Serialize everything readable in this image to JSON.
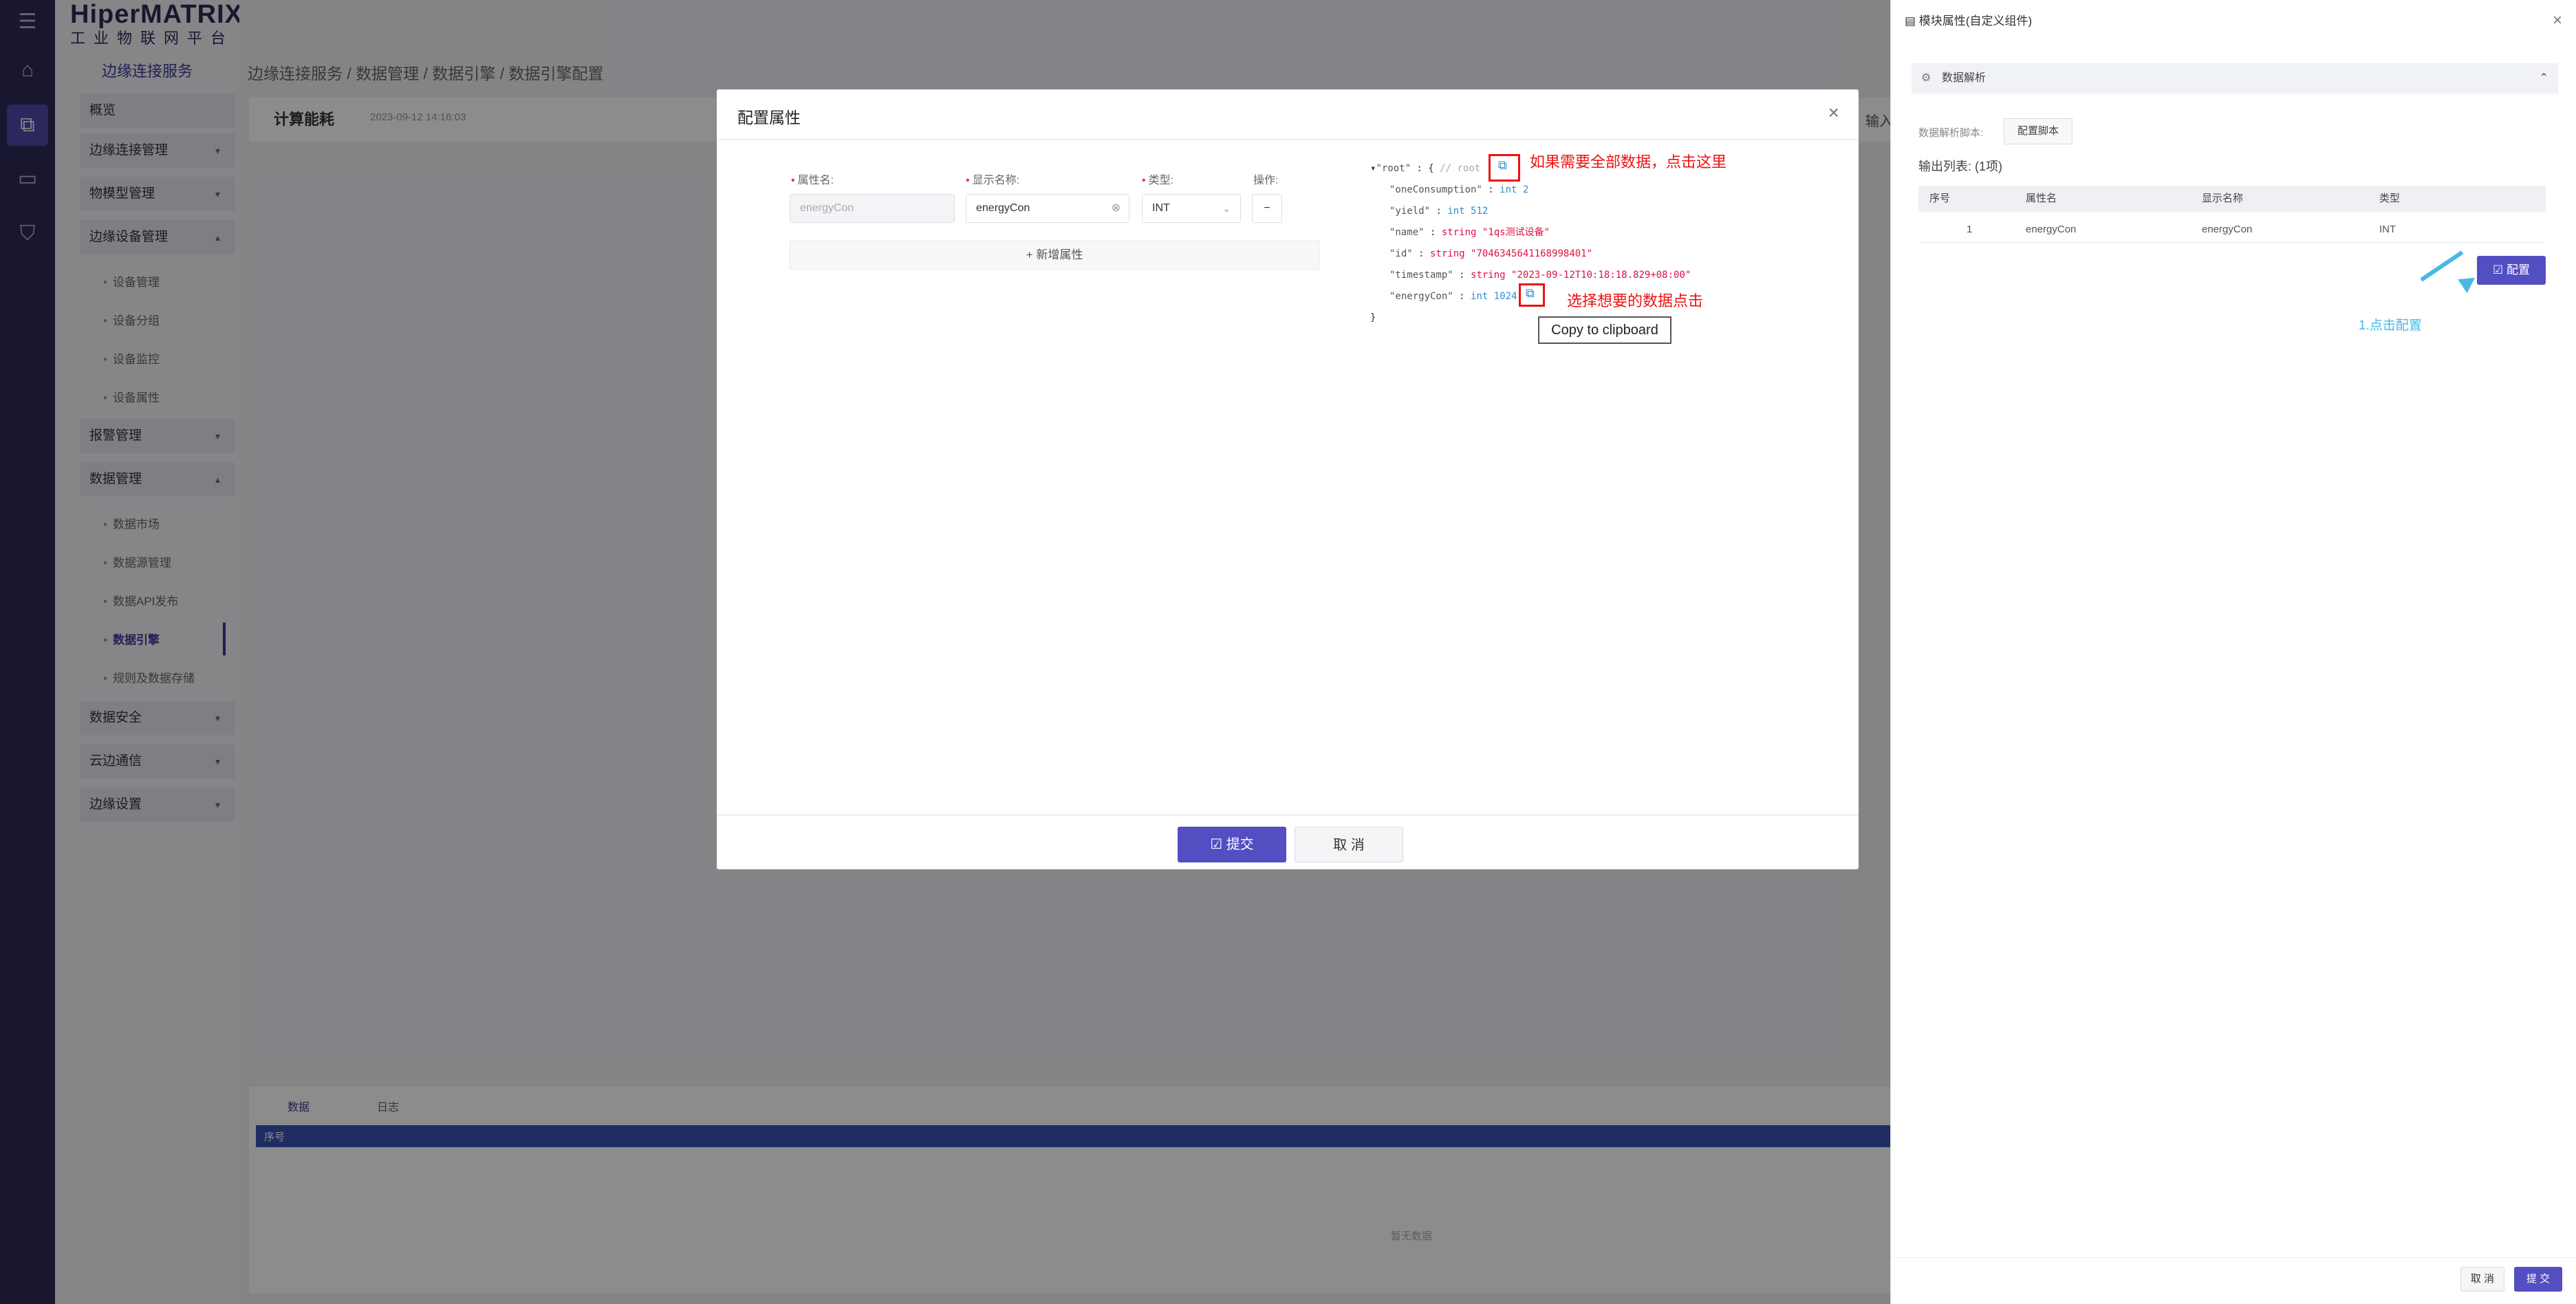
{
  "app": {
    "logo_brand": "HiperMATRIX",
    "logo_sub": "工业物联网平台",
    "section_title": "边缘连接服务"
  },
  "menu": [
    {
      "label": "概览"
    },
    {
      "label": "边缘连接管理"
    },
    {
      "label": "物模型管理"
    },
    {
      "label": "边缘设备管理"
    },
    {
      "label": "报警管理"
    },
    {
      "label": "数据管理"
    },
    {
      "label": "数据安全"
    },
    {
      "label": "云边通信"
    },
    {
      "label": "边缘设置"
    }
  ],
  "submenu_device": [
    "设备管理",
    "设备分组",
    "设备监控",
    "设备属性"
  ],
  "submenu_data": [
    "数据市场",
    "数据源管理",
    "数据API发布",
    "数据引擎",
    "规则及数据存储"
  ],
  "breadcrumb": "边缘连接服务 / 数据管理 / 数据引擎 / 数据引擎配置",
  "card": {
    "title": "计算能耗",
    "date": "2023-09-12 14:16:03",
    "right_text": "输入"
  },
  "bottom": {
    "tab_data": "数据",
    "tab_log": "日志",
    "col_index": "序号",
    "empty": "暂无数据"
  },
  "modal": {
    "title": "配置属性",
    "label_attr": "属性名:",
    "label_display": "显示名称:",
    "label_type": "类型:",
    "label_ops": "操作:",
    "attr_value": "energyCon",
    "display_value": "energyCon",
    "type_value": "INT",
    "add_attr": "新增属性",
    "submit": "提交",
    "cancel": "取 消"
  },
  "json_view": {
    "root_key": "\"root\"",
    "root_comment": "// root",
    "l1_key": "\"oneConsumption\"",
    "l1_type": "int",
    "l1_val": "2",
    "l2_key": "\"yield\"",
    "l2_type": "int",
    "l2_val": "512",
    "l3_key": "\"name\"",
    "l3_type": "string",
    "l3_val": "\"1qs测试设备\"",
    "l4_key": "\"id\"",
    "l4_type": "string",
    "l4_val": "\"7046345641168998401\"",
    "l5_key": "\"timestamp\"",
    "l5_type": "string",
    "l5_val": "\"2023-09-12T10:18:18.829+08:00\"",
    "l6_key": "\"energyCon\"",
    "l6_type": "int",
    "l6_val": "1024",
    "close_brace": "}"
  },
  "annotations": {
    "all_data": "如果需要全部数据，点击这里",
    "select_data": "选择想要的数据点击",
    "tooltip": "Copy to clipboard",
    "click_config": "1.点击配置"
  },
  "panel": {
    "title": "模块属性(自定义组件)",
    "section": "数据解析",
    "script_label": "数据解析脚本:",
    "script_button": "配置脚本",
    "output_label": "输出列表: (1项)",
    "columns": [
      "序号",
      "属性名",
      "显示名称",
      "类型"
    ],
    "rows": [
      [
        "1",
        "energyCon",
        "energyCon",
        "INT"
      ]
    ],
    "config_button": "配置",
    "cancel": "取 消",
    "submit": "提 交"
  },
  "colors": {
    "accent": "#534ec2",
    "annotation_red": "#e11111",
    "arrow": "#46b9e5"
  }
}
